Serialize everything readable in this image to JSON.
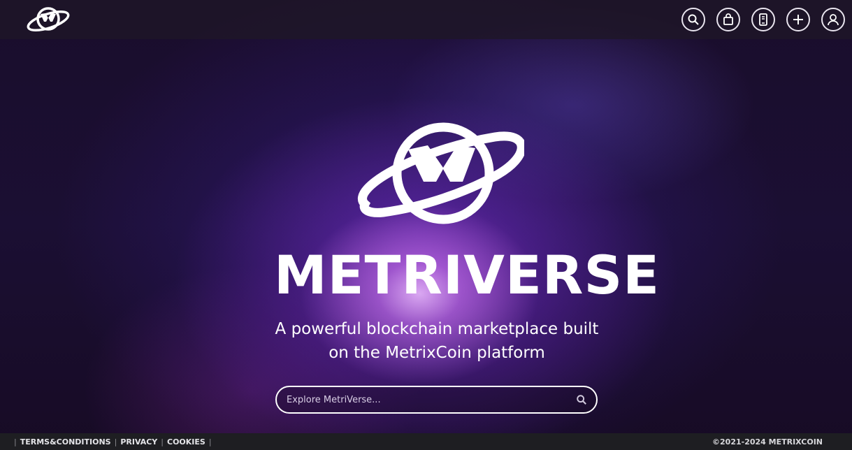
{
  "header": {
    "logo_icon": "metriverse-planet-logo",
    "icons": [
      {
        "name": "search-icon"
      },
      {
        "name": "shopping-bag-icon"
      },
      {
        "name": "mobile-app-icon"
      },
      {
        "name": "plus-icon"
      },
      {
        "name": "user-icon"
      }
    ]
  },
  "hero": {
    "logo_icon": "metriverse-planet-logo",
    "wordmark": "METRIVERSE",
    "tagline_line1": "A powerful blockchain marketplace built",
    "tagline_line2": "on the MetrixCoin platform"
  },
  "search": {
    "placeholder": "Explore MetriVerse..."
  },
  "footer": {
    "sep": "|",
    "links": [
      "TERMS&CONDITIONS",
      "PRIVACY",
      "COOKIES"
    ],
    "copyright": "©2021-2024 METRIXCOIN"
  },
  "colors": {
    "topbar": "#1e1628",
    "footer": "#1e1e22",
    "accent": "#ffffff"
  }
}
